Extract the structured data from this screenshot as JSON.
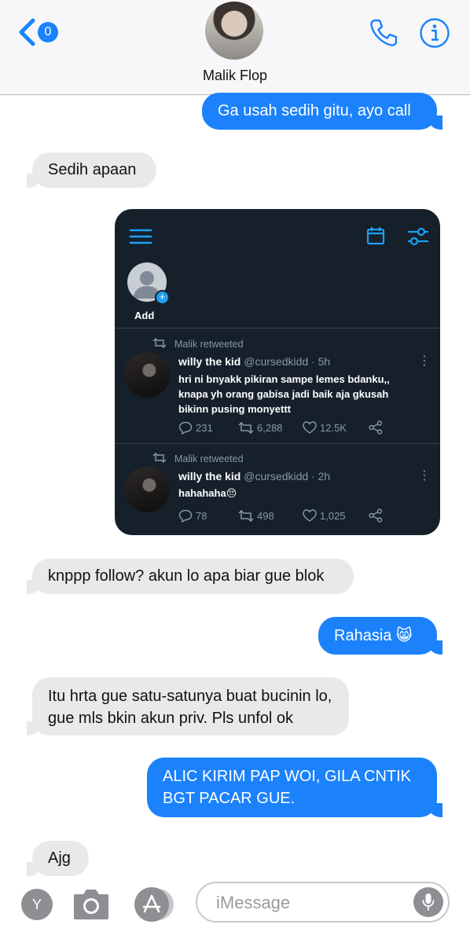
{
  "header": {
    "back_badge": "0",
    "contact_name": "Malik Flop",
    "icons": {
      "back": "chevron-left-icon",
      "call": "phone-icon",
      "info": "info-icon"
    }
  },
  "messages": [
    {
      "side": "sent",
      "text": "Ga usah sedih gitu, ayo call"
    },
    {
      "side": "received",
      "text": "Sedih apaan"
    },
    {
      "side": "received",
      "text": "knppp follow? akun lo apa biar gue blok"
    },
    {
      "side": "sent",
      "text": "Rahasia 😸"
    },
    {
      "side": "received",
      "text": "Itu hrta gue satu-satunya buat bucinin lo, gue mls bkin akun priv. Pls unfol ok"
    },
    {
      "side": "sent",
      "text": "ALIC KIRIM PAP WOI, GILA CNTIK BGT PACAR GUE."
    },
    {
      "side": "received",
      "text": "Ajg"
    }
  ],
  "screenshot": {
    "add_label": "Add",
    "tweets": [
      {
        "retweeted_by": "Malik retweeted",
        "name": "willy the kid",
        "handle_time": "@cursedkidd · 5h",
        "text": "hri ni bnyakk pikiran sampe lemes bdanku,, knapa yh orang gabisa jadi baik aja gkusah bikinn pusing monyettt",
        "replies": "231",
        "retweets": "6,288",
        "likes": "12.5K"
      },
      {
        "retweeted_by": "Malik retweeted",
        "name": "willy the kid",
        "handle_time": "@cursedkidd · 2h",
        "text": "hahahaha😔",
        "replies": "78",
        "retweets": "498",
        "likes": "1,025"
      }
    ],
    "colors": {
      "background": "#15202b",
      "accent": "#1da1f2",
      "muted": "#8899a6"
    }
  },
  "input_bar": {
    "avatar_letter": "Y",
    "placeholder": "iMessage"
  },
  "colors": {
    "sent_bubble": "#1b82fb",
    "received_bubble": "#e9e9eb",
    "ios_blue": "#1a82fb"
  }
}
